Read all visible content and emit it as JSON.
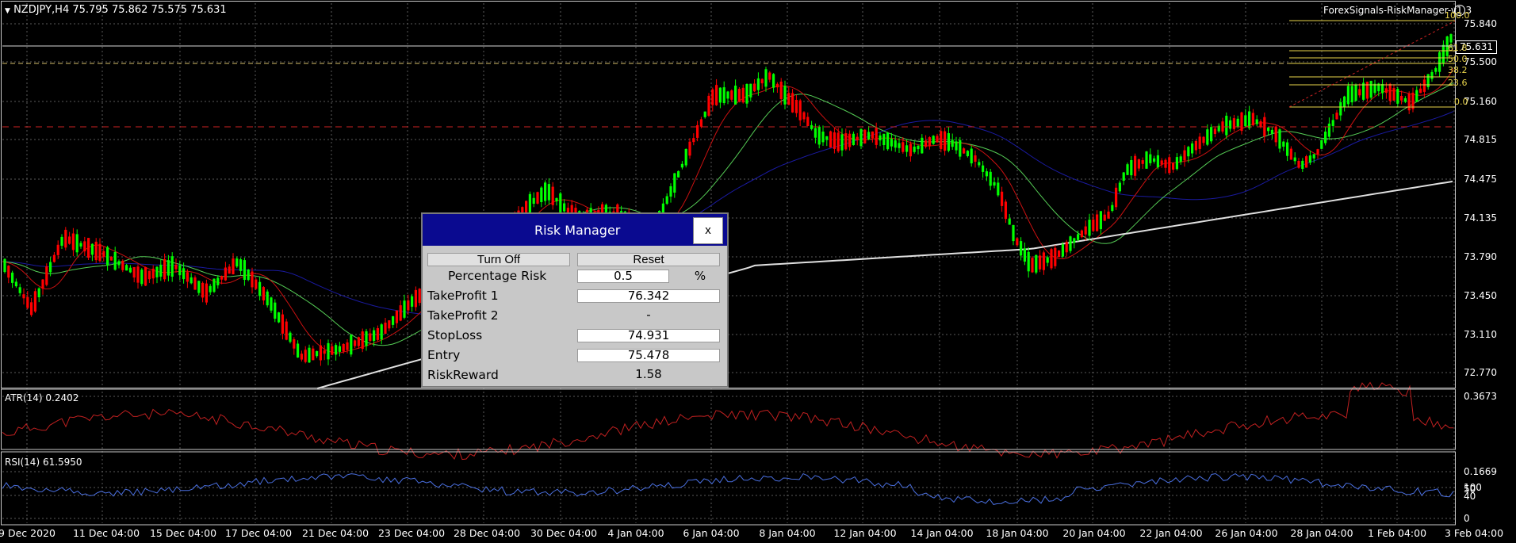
{
  "header": {
    "symbol_info": "NZDJPY,H4  75.795 75.862 75.575 75.631",
    "ea_name": "ForexSignals-RiskManager-v1.3"
  },
  "price_axis": [
    "75.840",
    "75.500",
    "75.160",
    "74.815",
    "74.475",
    "74.135",
    "73.790",
    "73.450",
    "73.110",
    "72.770"
  ],
  "current_price": "75.631",
  "time_axis": [
    "9 Dec 2020",
    "11 Dec 04:00",
    "15 Dec 04:00",
    "17 Dec 04:00",
    "21 Dec 04:00",
    "23 Dec 04:00",
    "28 Dec 04:00",
    "30 Dec 04:00",
    "4 Jan 04:00",
    "6 Jan 04:00",
    "8 Jan 04:00",
    "12 Jan 04:00",
    "14 Jan 04:00",
    "18 Jan 04:00",
    "20 Jan 04:00",
    "22 Jan 04:00",
    "26 Jan 04:00",
    "28 Jan 04:00",
    "1 Feb 04:00",
    "3 Feb 04:00"
  ],
  "fibonacci": [
    "100.0",
    "61.8",
    "50.0",
    "38.2",
    "23.6",
    "0.0"
  ],
  "atr": {
    "title": "ATR(14) 0.2402",
    "high": "0.3673",
    "low": "0.1669"
  },
  "rsi": {
    "title": "RSI(14) 61.5950",
    "levels": [
      "100",
      "50",
      "40",
      "0"
    ]
  },
  "colors": {
    "bull": "#00ff00",
    "bear": "#ff0000",
    "grid": "#5a5a5a",
    "ma_fast": "#cc1111",
    "ma_mid": "#55cc55",
    "ma_slow": "#1a1aa0",
    "ma_long": "#e0e0e0",
    "rsi": "#4a6fe0",
    "atr": "#c02020",
    "panel_title": "#0a0a90"
  },
  "risk_manager": {
    "title": "Risk Manager",
    "close": "x",
    "turn_off": "Turn Off",
    "reset": "Reset",
    "percentage_risk_label": "Percentage Risk",
    "percentage_risk_value": "0.5",
    "percent_sign": "%",
    "tp1_label": "TakeProfit 1",
    "tp1_value": "76.342",
    "tp2_label": "TakeProfit 2",
    "tp2_value": "-",
    "sl_label": "StopLoss",
    "sl_value": "74.931",
    "entry_label": "Entry",
    "entry_value": "75.478",
    "rr_label": "RiskReward",
    "rr_value": "1.58"
  }
}
